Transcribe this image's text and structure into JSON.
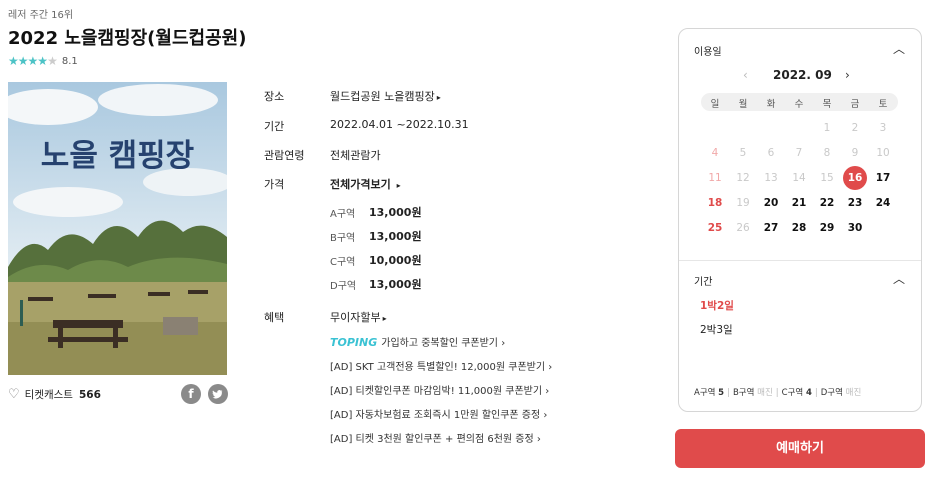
{
  "header": {
    "rank": "레저 주간 16위",
    "title": "2022 노을캠핑장(월드컵공원)",
    "rating_value": "8.1",
    "stars_filled": 4,
    "stars_total": 5
  },
  "poster": {
    "text": "노을 캠핑장"
  },
  "likes": {
    "label": "티켓캐스트",
    "count": "566"
  },
  "share": {
    "facebook": "f",
    "twitter": "t"
  },
  "info": {
    "place_label": "장소",
    "place_value": "월드컵공원 노을캠핑장",
    "period_label": "기간",
    "period_value": "2022.04.01 ~2022.10.31",
    "age_label": "관람연령",
    "age_value": "전체관람가",
    "price_label": "가격",
    "price_link": "전체가격보기",
    "prices": [
      {
        "zone": "A구역",
        "price": "13,000원"
      },
      {
        "zone": "B구역",
        "price": "13,000원"
      },
      {
        "zone": "C구역",
        "price": "10,000원"
      },
      {
        "zone": "D구역",
        "price": "13,000원"
      }
    ],
    "benefit_label": "혜택",
    "benefit_main": "무이자할부",
    "toping_logo": "TOPING",
    "benefits": [
      "가입하고 중복할인 쿠폰받기",
      "[AD] SKT 고객전용 특별할인! 12,000원 쿠폰받기",
      "[AD] 티켓할인쿠폰 마감임박! 11,000원 쿠폰받기",
      "[AD] 자동차보험료 조회즉시 1만원 할인쿠폰 증정",
      "[AD] 티켓 3천원 할인쿠폰 + 편의점 6천원 증정"
    ]
  },
  "calendar": {
    "section_title": "이용일",
    "month": "2022. 09",
    "weekdays": [
      "일",
      "월",
      "화",
      "수",
      "목",
      "금",
      "토"
    ],
    "selected_day": "16"
  },
  "period": {
    "section_title": "기간",
    "options": [
      "1박2일",
      "2박3일"
    ],
    "selected": "1박2일"
  },
  "zone_status": [
    {
      "zone": "A구역",
      "count": "5"
    },
    {
      "zone": "B구역",
      "count": "매진"
    },
    {
      "zone": "C구역",
      "count": "4"
    },
    {
      "zone": "D구역",
      "count": "매진"
    }
  ],
  "book_button": "예매하기",
  "colors": {
    "accent": "#e04b4b",
    "star": "#4cc3c6",
    "toping": "#3ac2d3"
  }
}
